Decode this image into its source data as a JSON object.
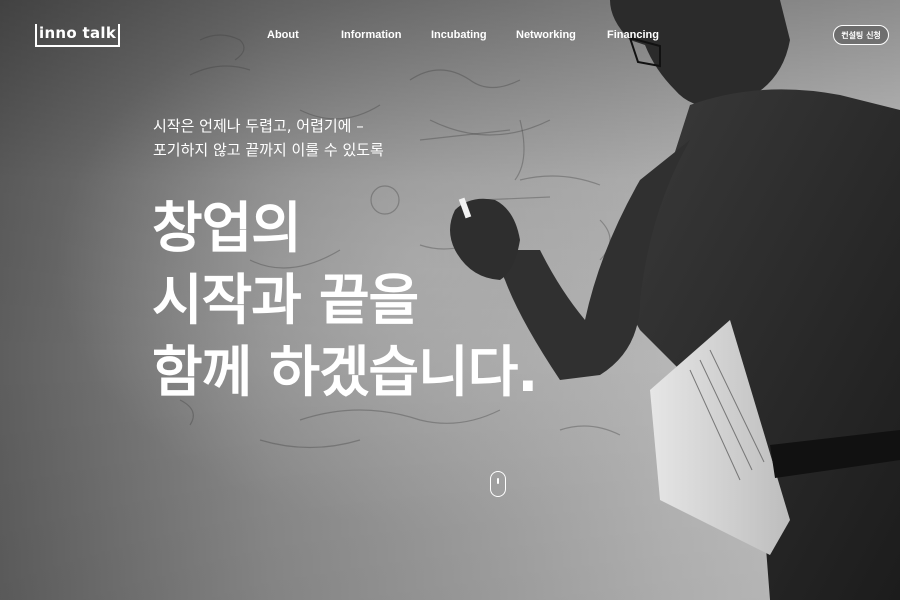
{
  "header": {
    "logo": "inno talk",
    "nav": [
      "About",
      "Information",
      "Incubating",
      "Networking",
      "Financing"
    ],
    "cta_label": "컨설팅 신청"
  },
  "hero": {
    "subtitle_lines": [
      "시작은 언제나 두렵고, 어렵기에 –",
      "포기하지 않고 끝까지 이룰 수 있도록"
    ],
    "headline_lines": [
      "창업의",
      "시작과 끝을",
      "함께 하겠습니다."
    ],
    "scroll_icon": "mouse-scroll-icon"
  },
  "colors": {
    "text": "#ffffff",
    "background_dark": "#2a2a2a",
    "background_light": "#c9c9c9"
  }
}
